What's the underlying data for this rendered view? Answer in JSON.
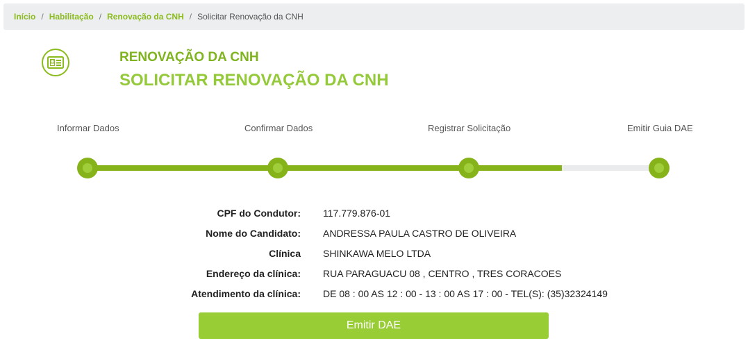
{
  "breadcrumb": {
    "items": [
      "Início",
      "Habilitação",
      "Renovação da CNH"
    ],
    "current": "Solicitar Renovação da CNH",
    "separator": "/"
  },
  "header": {
    "icon": "id-card-icon",
    "title": "RENOVAÇÃO DA CNH",
    "subtitle": "SOLICITAR RENOVAÇÃO DA CNH"
  },
  "steps": {
    "items": [
      {
        "label": "Informar Dados"
      },
      {
        "label": "Confirmar Dados"
      },
      {
        "label": "Registrar Solicitação"
      },
      {
        "label": "Emitir Guia DAE"
      }
    ],
    "progress_percent": 83
  },
  "details": {
    "rows": [
      {
        "label": "CPF do Condutor:",
        "value": "117.779.876-01"
      },
      {
        "label": "Nome do Candidato:",
        "value": "ANDRESSA PAULA CASTRO DE OLIVEIRA"
      },
      {
        "label": "Clínica",
        "value": "SHINKAWA MELO LTDA"
      },
      {
        "label": "Endereço da clínica:",
        "value": "RUA PARAGUACU 08 , CENTRO , TRES CORACOES"
      },
      {
        "label": "Atendimento da clínica:",
        "value": "DE 08 : 00 AS 12 : 00 - 13 : 00 AS 17 : 00 - TEL(S): (35)32324149"
      }
    ]
  },
  "action": {
    "emit_label": "Emitir DAE"
  },
  "colors": {
    "accent": "#87b31a",
    "button": "#98cd35",
    "breadcrumb_bg": "#eceef0"
  }
}
